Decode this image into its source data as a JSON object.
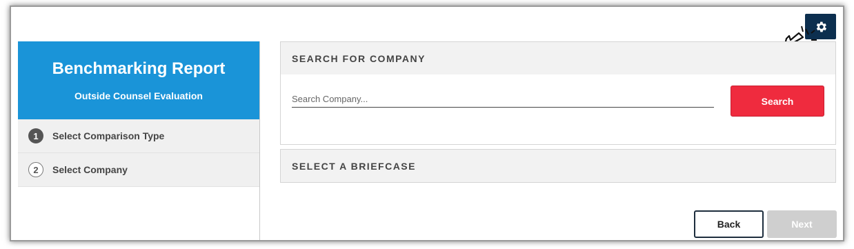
{
  "sidebar": {
    "title": "Benchmarking Report",
    "subtitle": "Outside Counsel Evaluation",
    "steps": [
      {
        "number": "1",
        "label": "Select Comparison Type",
        "state": "active"
      },
      {
        "number": "2",
        "label": "Select Company",
        "state": "inactive"
      }
    ]
  },
  "search_panel": {
    "title": "SEARCH FOR COMPANY",
    "placeholder": "Search Company...",
    "value": "",
    "button_label": "Search"
  },
  "briefcase_panel": {
    "title": "SELECT A BRIEFCASE"
  },
  "footer": {
    "back_label": "Back",
    "next_label": "Next"
  },
  "icons": {
    "settings": "gear-icon",
    "pointer": "click-cursor-icon"
  },
  "colors": {
    "header_blue": "#1a94d8",
    "search_red": "#ef2b3e",
    "settings_navy": "#0c2f4f",
    "next_disabled": "#cfcfcf"
  }
}
